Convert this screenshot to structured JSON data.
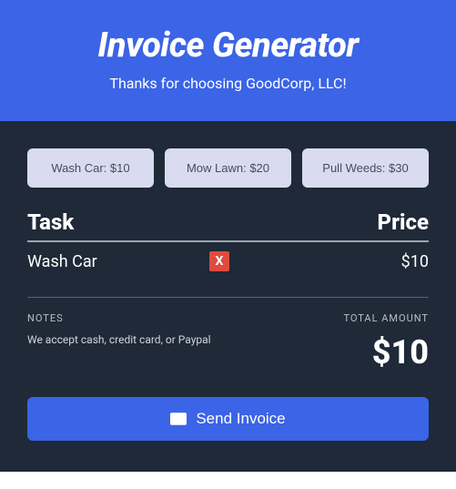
{
  "header": {
    "title": "Invoice Generator",
    "subtitle": "Thanks for choosing GoodCorp, LLC!"
  },
  "services": [
    {
      "label": "Wash Car: $10"
    },
    {
      "label": "Mow Lawn: $20"
    },
    {
      "label": "Pull Weeds: $30"
    }
  ],
  "table": {
    "task_header": "Task",
    "price_header": "Price",
    "rows": [
      {
        "task": "Wash Car",
        "remove": "X",
        "price": "$10"
      }
    ]
  },
  "footer": {
    "notes_label": "NOTES",
    "notes_text": "We accept cash, credit card, or Paypal",
    "total_label": "TOTAL AMOUNT",
    "total_amount": "$10"
  },
  "send_button": "Send Invoice"
}
